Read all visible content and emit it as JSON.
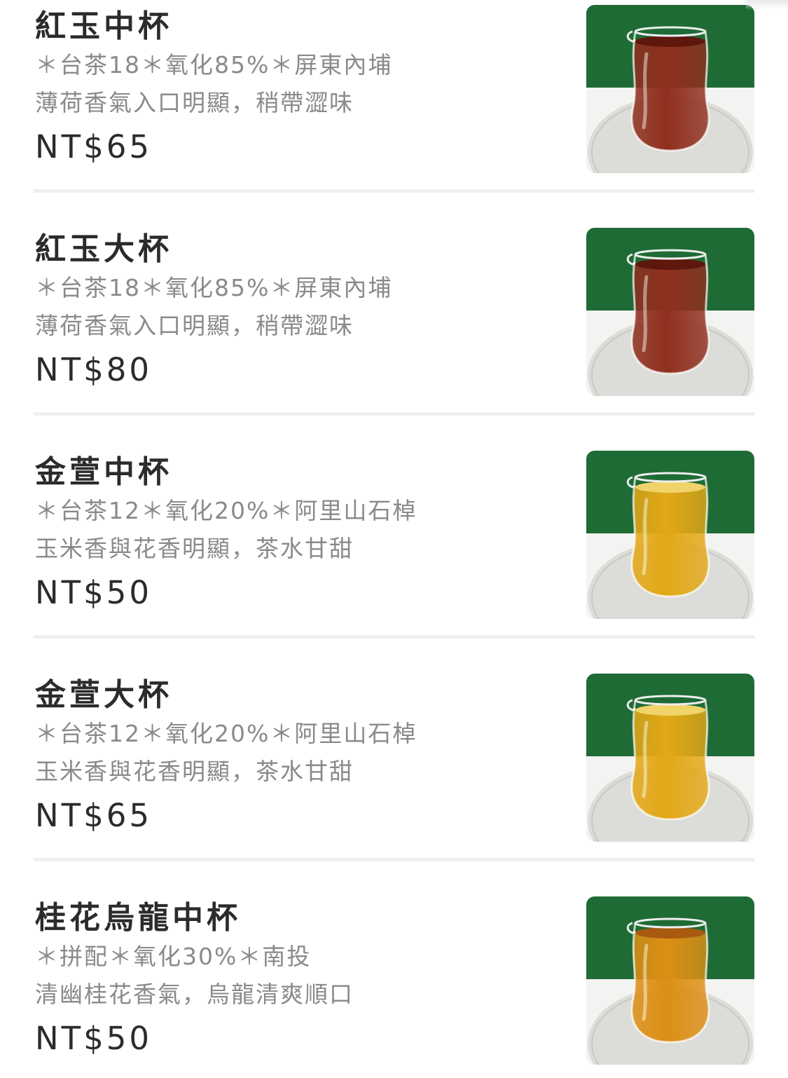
{
  "menu": {
    "items": [
      {
        "name": "紅玉中杯",
        "spec": "＊台茶18＊氧化85%＊屏東內埔",
        "desc": "薄荷香氣入口明顯，稍帶澀味",
        "price": "NT$65",
        "tea_color": "#8f2f1e",
        "tea_top": "#5e170d"
      },
      {
        "name": "紅玉大杯",
        "spec": "＊台茶18＊氧化85%＊屏東內埔",
        "desc": "薄荷香氣入口明顯，稍帶澀味",
        "price": "NT$80",
        "tea_color": "#8f2f1e",
        "tea_top": "#5e170d"
      },
      {
        "name": "金萱中杯",
        "spec": "＊台茶12＊氧化20%＊阿里山石棹",
        "desc": "玉米香與花香明顯，茶水甘甜",
        "price": "NT$50",
        "tea_color": "#e3a817",
        "tea_top": "#f0d46a"
      },
      {
        "name": "金萱大杯",
        "spec": "＊台茶12＊氧化20%＊阿里山石棹",
        "desc": "玉米香與花香明顯，茶水甘甜",
        "price": "NT$65",
        "tea_color": "#e3a817",
        "tea_top": "#f0d46a"
      },
      {
        "name": "桂花烏龍中杯",
        "spec": "＊拼配＊氧化30%＊南投",
        "desc": "清幽桂花香氣，烏龍清爽順口",
        "price": "NT$50",
        "tea_color": "#dc8f14",
        "tea_top": "#a85a10"
      }
    ]
  },
  "photo": {
    "backdrop_color": "#1f6b35",
    "table_color": "#f3f3f1",
    "coaster_color": "#dcdcd8"
  }
}
